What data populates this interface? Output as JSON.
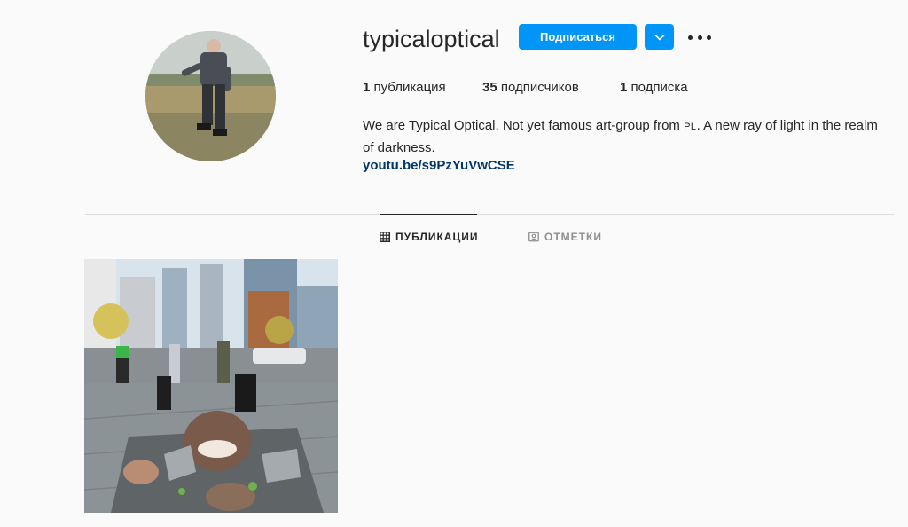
{
  "profile": {
    "username": "typicaloptical",
    "follow_label": "Подписаться",
    "stats": {
      "posts_count": "1",
      "posts_label": "публикация",
      "followers_count": "35",
      "followers_label": "подписчиков",
      "following_count": "1",
      "following_label": "подписка"
    },
    "bio_part1": "We are Typical Optical. Not yet famous art-group from ",
    "bio_pl": "PL",
    "bio_part2": ". A new ray of light in the realm of darkness.",
    "link": "youtu.be/s9PzYuVwCSE"
  },
  "tabs": [
    {
      "label": "ПУБЛИКАЦИИ",
      "icon": "grid-icon",
      "active": true
    },
    {
      "label": "ОТМЕТКИ",
      "icon": "tagged-icon",
      "active": false
    }
  ],
  "colors": {
    "accent": "#0095f6",
    "link": "#00376b",
    "inactive_tab": "#8e8e8e"
  }
}
